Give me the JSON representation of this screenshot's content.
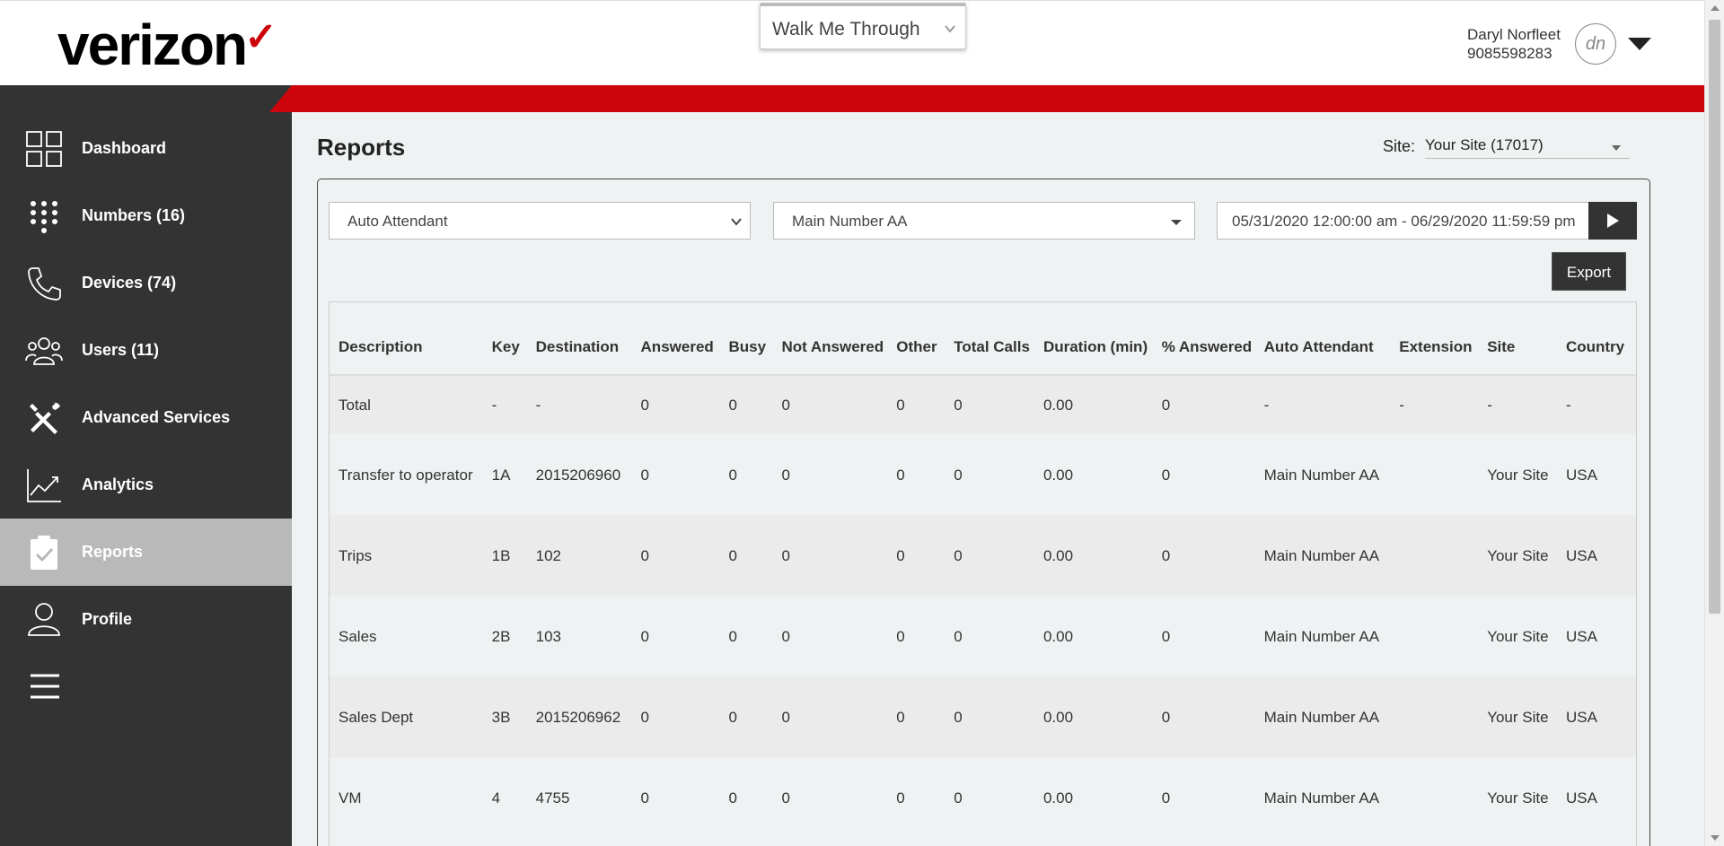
{
  "header": {
    "logo_text": "verizon",
    "logo_check": "✓",
    "walkme_label": "Walk Me Through",
    "user_name": "Daryl Norfleet",
    "user_phone": "9085598283",
    "avatar_initials": "dn"
  },
  "sidebar": {
    "items": [
      {
        "label": "Dashboard",
        "icon": "dashboard-grid-icon"
      },
      {
        "label": "Numbers (16)",
        "icon": "keypad-icon"
      },
      {
        "label": "Devices (74)",
        "icon": "phone-icon"
      },
      {
        "label": "Users (11)",
        "icon": "users-icon"
      },
      {
        "label": "Advanced Services",
        "icon": "tools-icon"
      },
      {
        "label": "Analytics",
        "icon": "analytics-icon"
      },
      {
        "label": "Reports",
        "icon": "clipboard-check-icon",
        "active": true
      },
      {
        "label": "Profile",
        "icon": "profile-icon"
      }
    ],
    "menu_icon": "hamburger-menu-icon"
  },
  "main": {
    "title": "Reports",
    "site_label": "Site:",
    "site_value": "Your Site (17017)",
    "report_type": "Auto Attendant",
    "report_target": "Main Number AA",
    "date_range": "05/31/2020 12:00:00 am - 06/29/2020 11:59:59 pm",
    "export_label": "Export"
  },
  "table": {
    "headers": [
      "Description",
      "Key",
      "Destination",
      "Answered",
      "Busy",
      "Not Answered",
      "Other",
      "Total Calls",
      "Duration (min)",
      "% Answered",
      "Auto Attendant",
      "Extension",
      "Site",
      "Country"
    ],
    "total_row": [
      "Total",
      "-",
      "-",
      "0",
      "0",
      "0",
      "0",
      "0",
      "0.00",
      "0",
      "-",
      "-",
      "-",
      "-"
    ],
    "rows": [
      [
        "Transfer to operator",
        "1A",
        "2015206960",
        "0",
        "0",
        "0",
        "0",
        "0",
        "0.00",
        "0",
        "Main Number AA",
        "",
        "Your Site",
        "USA"
      ],
      [
        "Trips",
        "1B",
        "102",
        "0",
        "0",
        "0",
        "0",
        "0",
        "0.00",
        "0",
        "Main Number AA",
        "",
        "Your Site",
        "USA"
      ],
      [
        "Sales",
        "2B",
        "103",
        "0",
        "0",
        "0",
        "0",
        "0",
        "0.00",
        "0",
        "Main Number AA",
        "",
        "Your Site",
        "USA"
      ],
      [
        "Sales Dept",
        "3B",
        "2015206962",
        "0",
        "0",
        "0",
        "0",
        "0",
        "0.00",
        "0",
        "Main Number AA",
        "",
        "Your Site",
        "USA"
      ],
      [
        "VM",
        "4",
        "4755",
        "0",
        "0",
        "0",
        "0",
        "0",
        "0.00",
        "0",
        "Main Number AA",
        "",
        "Your Site",
        "USA"
      ]
    ]
  },
  "colors": {
    "brand_red": "#cd040b",
    "sidebar_bg": "#333333",
    "active_item": "#b9b9b9",
    "content_bg": "#eff2f3"
  }
}
